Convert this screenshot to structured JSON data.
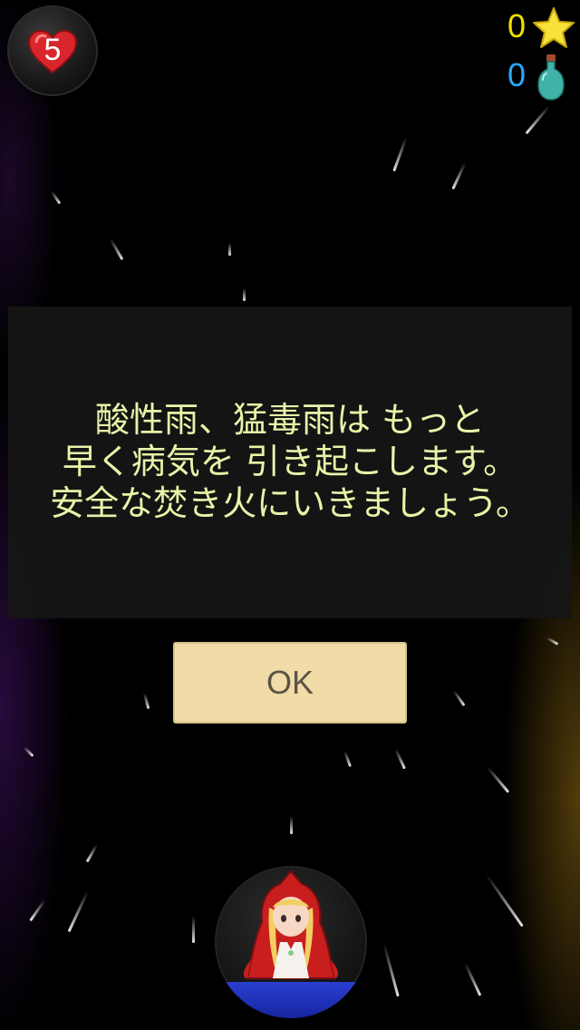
{
  "hud": {
    "lives": "5",
    "stars": "0",
    "potions": "0"
  },
  "dialog": {
    "lines": [
      "酸性雨、猛毒雨は もっと",
      "早く病気を 引き起こします。",
      "安全な焚き火にいきましょう。"
    ],
    "ok_label": "OK"
  },
  "colors": {
    "star_count": "#f0e000",
    "potion_count": "#2aa8ff",
    "dialog_text": "#e9f2a8",
    "ok_button": "#f1dca7"
  },
  "icons": {
    "lives": "heart-icon",
    "stars": "star-icon",
    "potions": "potion-bottle-icon",
    "character": "red-riding-hood"
  }
}
